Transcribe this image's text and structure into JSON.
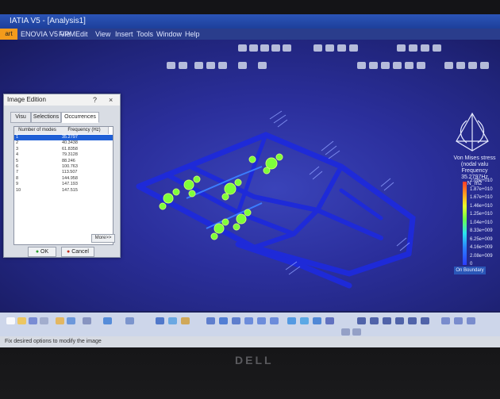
{
  "window": {
    "title": "IATIA V5 - [Analysis1]"
  },
  "menubar": {
    "start_label": "art",
    "items": [
      "ENOVIA V5 VPM",
      "File",
      "Edit",
      "View",
      "Insert",
      "Tools",
      "Window",
      "Help"
    ]
  },
  "dialog": {
    "title": "Image Edition",
    "help_label": "?",
    "close_label": "×",
    "tabs": [
      "Visu",
      "Selections",
      "Occurrences"
    ],
    "columns": [
      "Number of modes",
      "Frequency (Hz)"
    ],
    "rows": [
      {
        "mode": "1",
        "freq": "35.2797"
      },
      {
        "mode": "2",
        "freq": "40.3438"
      },
      {
        "mode": "3",
        "freq": "61.8358"
      },
      {
        "mode": "4",
        "freq": "79.3128"
      },
      {
        "mode": "5",
        "freq": "88.246"
      },
      {
        "mode": "6",
        "freq": "100.763"
      },
      {
        "mode": "7",
        "freq": "113.507"
      },
      {
        "mode": "8",
        "freq": "144.958"
      },
      {
        "mode": "9",
        "freq": "147.193"
      },
      {
        "mode": "10",
        "freq": "147.515"
      }
    ],
    "selected_index": 0,
    "more_label": "More>>",
    "ok_label": "OK",
    "cancel_label": "Cancel"
  },
  "legend": {
    "title_lines": [
      "Von Mises stress (nodal valu",
      "Frequency 35.2797Hz",
      "N_m2"
    ],
    "ticks": [
      "2.08e+010",
      "1.87e+010",
      "1.67e+010",
      "1.46e+010",
      "1.25e+010",
      "1.04e+010",
      "8.33e+009",
      "6.25e+009",
      "4.16e+009",
      "2.08e+009",
      "0"
    ],
    "boundary_label": "On Boundary",
    "colors": {
      "max": "#ff3a2a",
      "mid": "#6cff47",
      "min": "#2b3cff"
    }
  },
  "status": {
    "message": "Fix desired options to modify the image"
  },
  "monitor": {
    "brand": "DELL"
  }
}
